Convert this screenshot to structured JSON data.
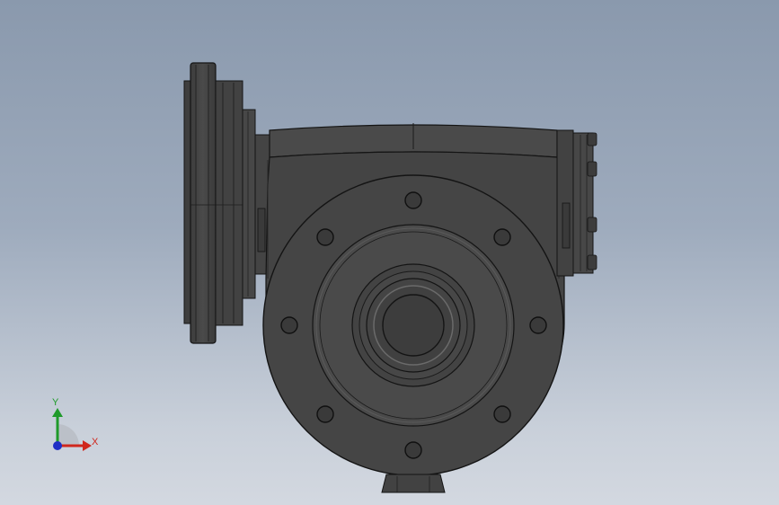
{
  "viewport": {
    "background_top": "#8a99ad",
    "background_bottom": "#d3d8e0"
  },
  "model": {
    "part_color": "#444444",
    "edge_color": "#141414",
    "highlight_color": "#5c5c5c"
  },
  "triad": {
    "x_label": "X",
    "y_label": "Y",
    "x_color": "#d0271d",
    "y_color": "#1f9a2a",
    "z_color": "#1f2fc6"
  }
}
